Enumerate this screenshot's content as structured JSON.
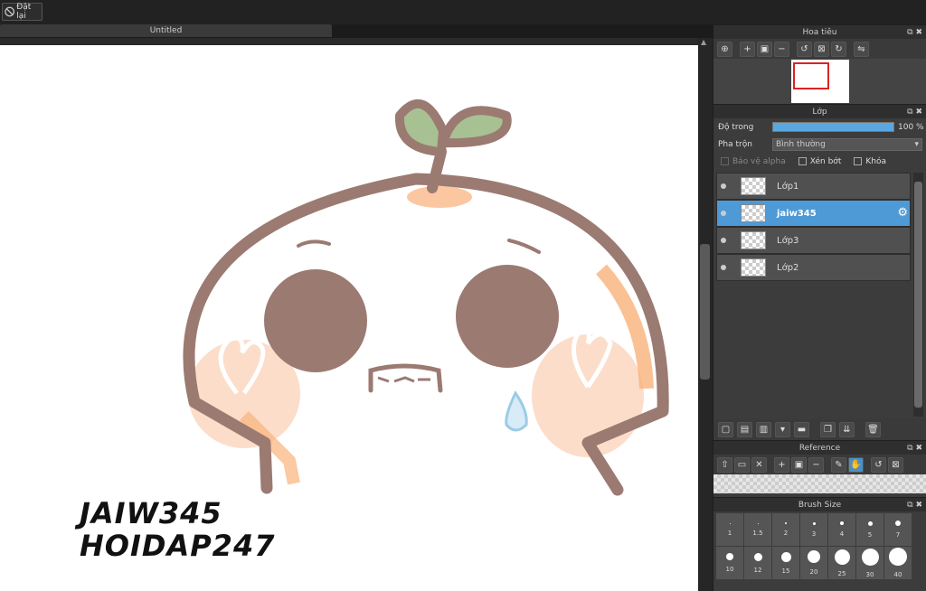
{
  "toolbar": {
    "reset_label": "Đặt lại"
  },
  "document": {
    "tab_title": "Untitled"
  },
  "canvas": {
    "watermark_line1": "JAIW345",
    "watermark_line2": "HOIDAP247"
  },
  "navigator": {
    "title": "Hoa tiêu"
  },
  "layer_panel": {
    "title": "Lớp",
    "opacity_label": "Độ trong",
    "opacity_value": "100 %",
    "opacity_percent": 100,
    "blend_label": "Pha trộn",
    "blend_value": "Bình thường",
    "alpha_lock_label": "Bảo vệ alpha",
    "clipping_label": "Xén bớt",
    "lock_label": "Khóa",
    "layers": [
      {
        "name": "Lớp1"
      },
      {
        "name": "jaiw345"
      },
      {
        "name": "Lớp3"
      },
      {
        "name": "Lớp2"
      }
    ]
  },
  "reference": {
    "title": "Reference"
  },
  "brush_size": {
    "title": "Brush Size",
    "sizes": [
      "1",
      "1.5",
      "2",
      "3",
      "4",
      "5",
      "7",
      "10",
      "12",
      "15",
      "20",
      "25",
      "30",
      "40"
    ]
  },
  "colors": {
    "accent": "#4d9ad6",
    "panel": "#3c3c3c",
    "character_outline": "#9b7a72",
    "blush": "#f9b27a"
  }
}
